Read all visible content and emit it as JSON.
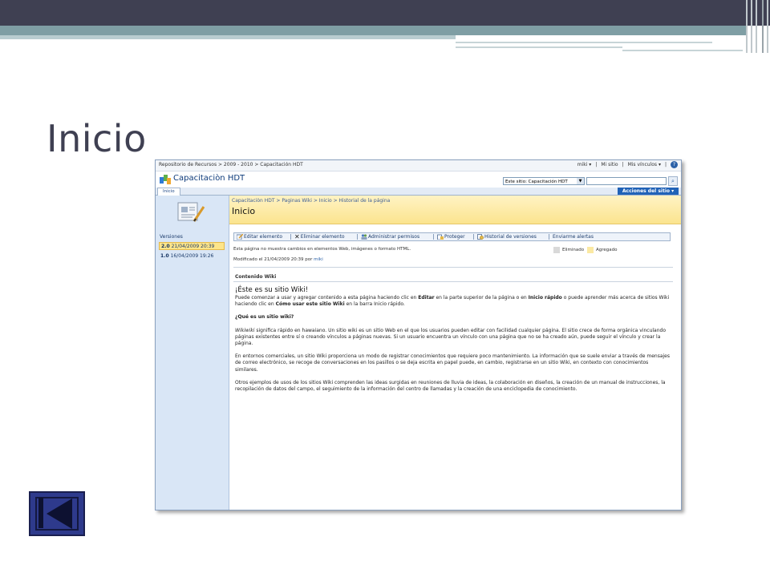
{
  "slide": {
    "title": "Inicio",
    "colors": {
      "top_bar": "#3f4052",
      "band": "#7f9ea4",
      "title_text": "#3f4052",
      "nav_button": "#2e3a8c"
    }
  },
  "nav_button": {
    "icon": "skip-to-start-icon"
  },
  "sharepoint": {
    "top_breadcrumb": "Repositorio de Recursos > 2009 - 2010 > Capacitación HDT",
    "user_menu": "miki ▾",
    "my_site": "Mi sitio",
    "my_links": "Mis vínculos ▾",
    "help_icon": "?",
    "site_title": "Capacitaciòn HDT",
    "search_scope": "Este sitio: Capacitación HDT",
    "search_query": "",
    "search_go_icon": "search-icon",
    "nav_tab": "Inicio",
    "site_actions": "Acciones del sitio ▾",
    "left_nav": {
      "versions_title": "Versiones",
      "versions": [
        {
          "number": "2.0",
          "date": "21/04/2009 20:39",
          "active": true
        },
        {
          "number": "1.0",
          "date": "16/04/2009 19:26",
          "active": false
        }
      ]
    },
    "page": {
      "breadcrumb": "Capacitaciòn HDT > Paginas Wiki > Inicio > Historial de la página",
      "title": "Inicio",
      "toolbar": {
        "edit": "Editar elemento",
        "delete": "Eliminar elemento",
        "permissions": "Administrar permisos",
        "protect": "Proteger",
        "history": "Historial de versiones",
        "alerts": "Enviarme alertas"
      },
      "info": "Esta página no muestra cambios en elementos Web, imágenes o formato HTML.",
      "modified_label": "Modificado el 21/04/2009 20:39  por",
      "modified_by": "miki",
      "legend_deleted": "Eliminado",
      "legend_added": "Agregado",
      "legend_colors": {
        "deleted": "#d9d9d9",
        "added": "#fbe9a3"
      },
      "content_label": "Contenido Wiki",
      "wiki": {
        "heading": "¡Éste es su sitio Wiki!",
        "intro_1": "Puede comenzar a usar y agregar contenido a esta página haciendo clic en ",
        "intro_edit": "Editar",
        "intro_2": " en la parte superior de la página o en ",
        "intro_quick": "Inicio rápido",
        "intro_3": " o puede aprender más acerca de sitios Wiki haciendo clic en ",
        "intro_how": "Cómo usar este sitio Wiki",
        "intro_4": " en la barra Inicio rápido.",
        "what_title": "¿Qué es un sitio wiki?",
        "para1_word": "Wikiwiki",
        "para1": " significa rápido en hawaiano. Un sitio wiki es un sitio Web en el que los usuarios pueden editar con facilidad cualquier página. El sitio crece de forma orgánica vinculando páginas existentes entre sí o creando vínculos a páginas nuevas. Si un usuario encuentra un vínculo con una página que no se ha creado aún, puede seguir el vínculo y crear la página.",
        "para2": "En entornos comerciales, un sitio Wiki proporciona un modo de registrar conocimientos que requiere poco mantenimiento. La información que se suele enviar a través de mensajes de correo electrónico, se recoge de conversaciones en los pasillos o se deja escrita en papel puede, en cambio, registrarse en un sitio Wiki, en contexto con conocimientos similares.",
        "para3": "Otros ejemplos de usos de los sitios Wiki comprenden las ideas surgidas en reuniones de lluvia de ideas, la colaboración en diseños, la creación de un manual de instrucciones, la recopilación de datos del campo, el seguimiento de la información del centro de llamadas y la creación de una enciclopedia de conocimiento."
      }
    }
  }
}
